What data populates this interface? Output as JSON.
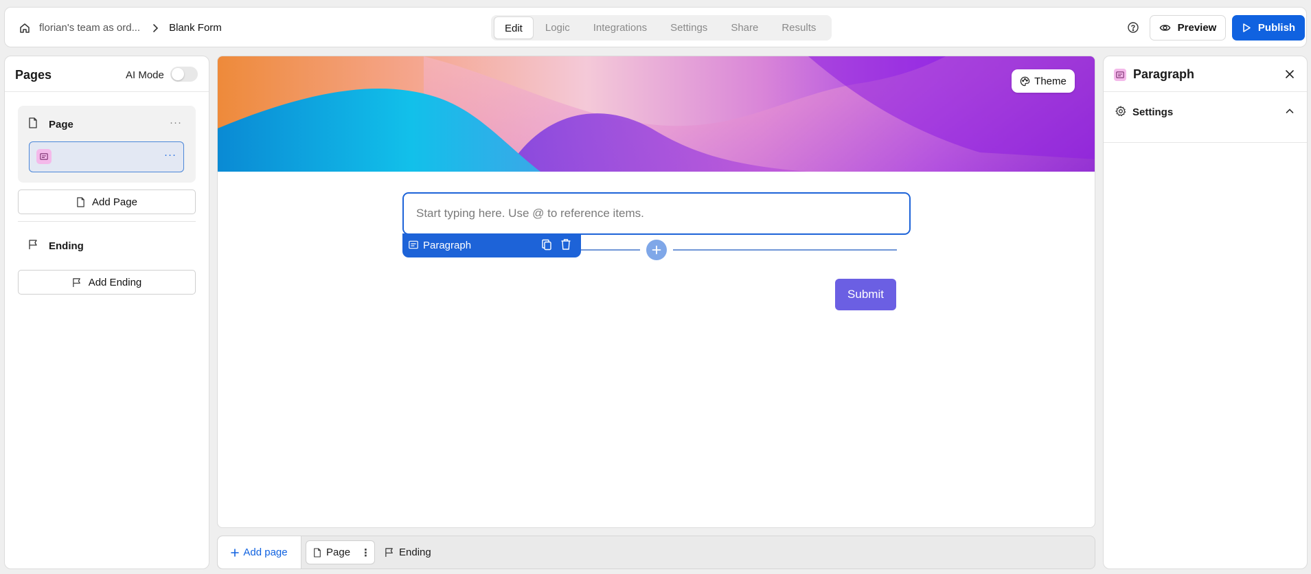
{
  "header": {
    "breadcrumb_team": "florian's team as ord...",
    "breadcrumb_form": "Blank Form",
    "tabs": [
      {
        "label": "Edit",
        "active": true
      },
      {
        "label": "Logic",
        "active": false
      },
      {
        "label": "Integrations",
        "active": false
      },
      {
        "label": "Settings",
        "active": false
      },
      {
        "label": "Share",
        "active": false
      },
      {
        "label": "Results",
        "active": false
      }
    ],
    "preview_label": "Preview",
    "publish_label": "Publish"
  },
  "left_panel": {
    "title": "Pages",
    "ai_mode_label": "AI Mode",
    "ai_mode_on": false,
    "page_label": "Page",
    "add_page_label": "Add Page",
    "ending_label": "Ending",
    "add_ending_label": "Add Ending"
  },
  "canvas": {
    "theme_label": "Theme",
    "paragraph_placeholder": "Start typing here. Use @ to reference items.",
    "paragraph_tag_label": "Paragraph",
    "submit_label": "Submit"
  },
  "bottom_bar": {
    "add_page_label": "Add page",
    "page_label": "Page",
    "ending_label": "Ending"
  },
  "right_panel": {
    "title": "Paragraph",
    "settings_label": "Settings"
  },
  "colors": {
    "accent": "#1062e0",
    "selection": "#1d63d8",
    "submit": "#6b5fe3",
    "paragraph_badge": "#f4b9ea"
  },
  "icons": [
    "home-icon",
    "chevron-right-icon",
    "help-icon",
    "eye-icon",
    "play-icon",
    "file-icon",
    "paragraph-icon",
    "flag-icon",
    "palette-icon",
    "copy-icon",
    "trash-icon",
    "plus-icon",
    "close-icon",
    "gear-icon",
    "chevron-up-icon"
  ]
}
